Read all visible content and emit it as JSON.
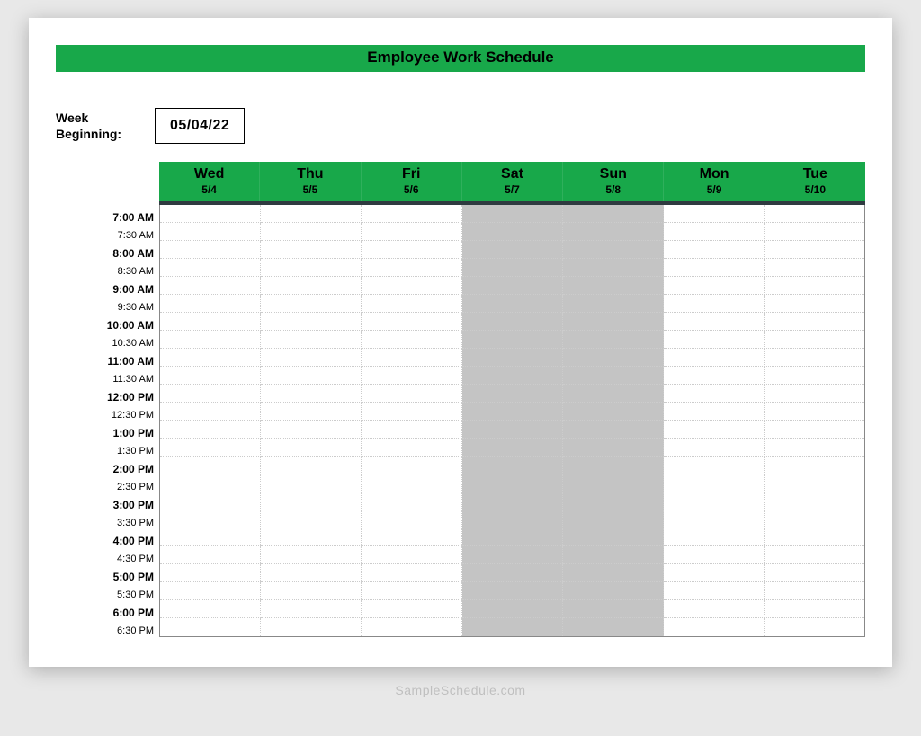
{
  "title": "Employee Work Schedule",
  "week_label": "Week Beginning:",
  "week_value": "05/04/22",
  "days": [
    {
      "name": "Wed",
      "date": "5/4",
      "weekend": false
    },
    {
      "name": "Thu",
      "date": "5/5",
      "weekend": false
    },
    {
      "name": "Fri",
      "date": "5/6",
      "weekend": false
    },
    {
      "name": "Sat",
      "date": "5/7",
      "weekend": true
    },
    {
      "name": "Sun",
      "date": "5/8",
      "weekend": true
    },
    {
      "name": "Mon",
      "date": "5/9",
      "weekend": false
    },
    {
      "name": "Tue",
      "date": "5/10",
      "weekend": false
    }
  ],
  "times": [
    {
      "label": "7:00 AM",
      "bold": true
    },
    {
      "label": "7:30 AM",
      "bold": false
    },
    {
      "label": "8:00 AM",
      "bold": true
    },
    {
      "label": "8:30 AM",
      "bold": false
    },
    {
      "label": "9:00 AM",
      "bold": true
    },
    {
      "label": "9:30 AM",
      "bold": false
    },
    {
      "label": "10:00 AM",
      "bold": true
    },
    {
      "label": "10:30 AM",
      "bold": false
    },
    {
      "label": "11:00 AM",
      "bold": true
    },
    {
      "label": "11:30 AM",
      "bold": false
    },
    {
      "label": "12:00 PM",
      "bold": true
    },
    {
      "label": "12:30 PM",
      "bold": false
    },
    {
      "label": "1:00 PM",
      "bold": true
    },
    {
      "label": "1:30 PM",
      "bold": false
    },
    {
      "label": "2:00 PM",
      "bold": true
    },
    {
      "label": "2:30 PM",
      "bold": false
    },
    {
      "label": "3:00 PM",
      "bold": true
    },
    {
      "label": "3:30 PM",
      "bold": false
    },
    {
      "label": "4:00 PM",
      "bold": true
    },
    {
      "label": "4:30 PM",
      "bold": false
    },
    {
      "label": "5:00 PM",
      "bold": true
    },
    {
      "label": "5:30 PM",
      "bold": false
    },
    {
      "label": "6:00 PM",
      "bold": true
    },
    {
      "label": "6:30 PM",
      "bold": false
    }
  ],
  "footer": "SampleSchedule.com"
}
